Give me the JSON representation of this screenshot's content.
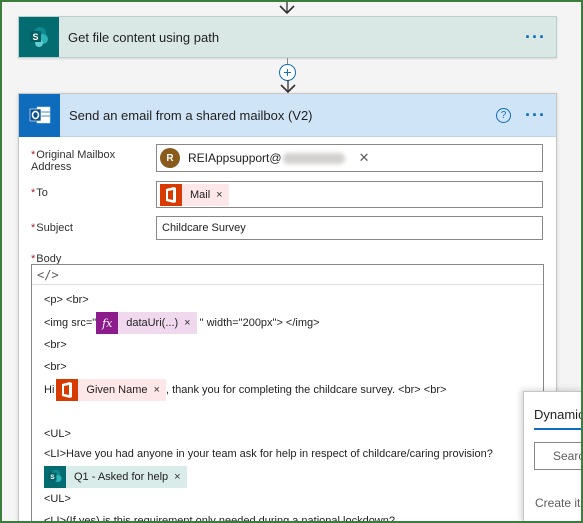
{
  "sharepoint_step": {
    "title": "Get file content using path",
    "menu_glyph": "···",
    "icon": "sharepoint-icon",
    "color": "#036c70"
  },
  "connector": {
    "plus_glyph": "+"
  },
  "email_step": {
    "title": "Send an email from a shared mailbox (V2)",
    "help_glyph": "?",
    "menu_glyph": "···",
    "icon": "outlook-icon",
    "color": "#0f6cbd",
    "fields": {
      "original_mailbox": {
        "required": "*",
        "label_line1": "Original Mailbox",
        "label_line2": "Address",
        "avatar_initial": "R",
        "value": "REIAppsupport@",
        "remove_glyph": "✕"
      },
      "to": {
        "required": "*",
        "label": "To",
        "token_label": "Mail",
        "token_remove": "×"
      },
      "subject": {
        "required": "*",
        "label": "Subject",
        "value": "Childcare Survey"
      },
      "body": {
        "required": "*",
        "label": "Body",
        "code_toggle": "</>",
        "lines": {
          "l1": "<p> <br>",
          "l2_before": "<img src=\"",
          "l2_fx_label": "dataUri(...)",
          "l2_fx_glyph": "fx",
          "l2_fx_remove": "×",
          "l2_after": "\" width=\"200px\"> </img>",
          "l3": "<br>",
          "l4": "<br>",
          "l5_before": "Hi",
          "l5_token": "Given Name",
          "l5_token_remove": "×",
          "l5_after": ", thank you for completing the childcare survey. <br> <br>",
          "l6": "<UL>",
          "l7": "<LI>Have you had anyone in your team ask for help in respect of childcare/caring provision?",
          "l8_token": "Q1 - Asked for help",
          "l8_token_remove": "×",
          "l9": "<UL>",
          "l10": "<LI>(If yes) is this requirement only needed during a national lockdown?"
        }
      }
    }
  },
  "dynamic_panel": {
    "title": "Dynamic content",
    "search_placeholder": "Search dynamic content",
    "create_text": "Create items"
  }
}
